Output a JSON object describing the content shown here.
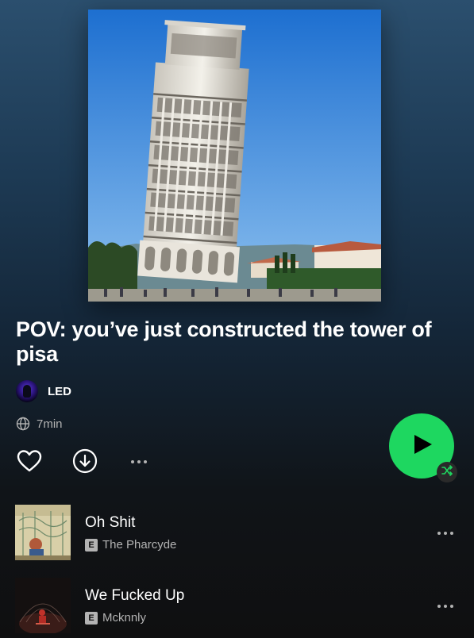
{
  "playlist": {
    "title": "POV: you’ve just constructed the tower of pisa",
    "owner": "LED",
    "duration": "7min"
  },
  "icons": {
    "like": "heart-icon",
    "download": "download-icon",
    "more": "more-options-icon",
    "play": "play-icon",
    "shuffle": "shuffle-icon",
    "visibility": "globe-icon"
  },
  "colors": {
    "accent": "#1ed760",
    "text": "#ffffff",
    "subtext": "#b3b3b3"
  },
  "tracks": [
    {
      "title": "Oh Shit",
      "explicit_badge": "E",
      "artist": "The Pharcyde"
    },
    {
      "title": "We Fucked Up",
      "explicit_badge": "E",
      "artist": "Mcknnly"
    }
  ]
}
